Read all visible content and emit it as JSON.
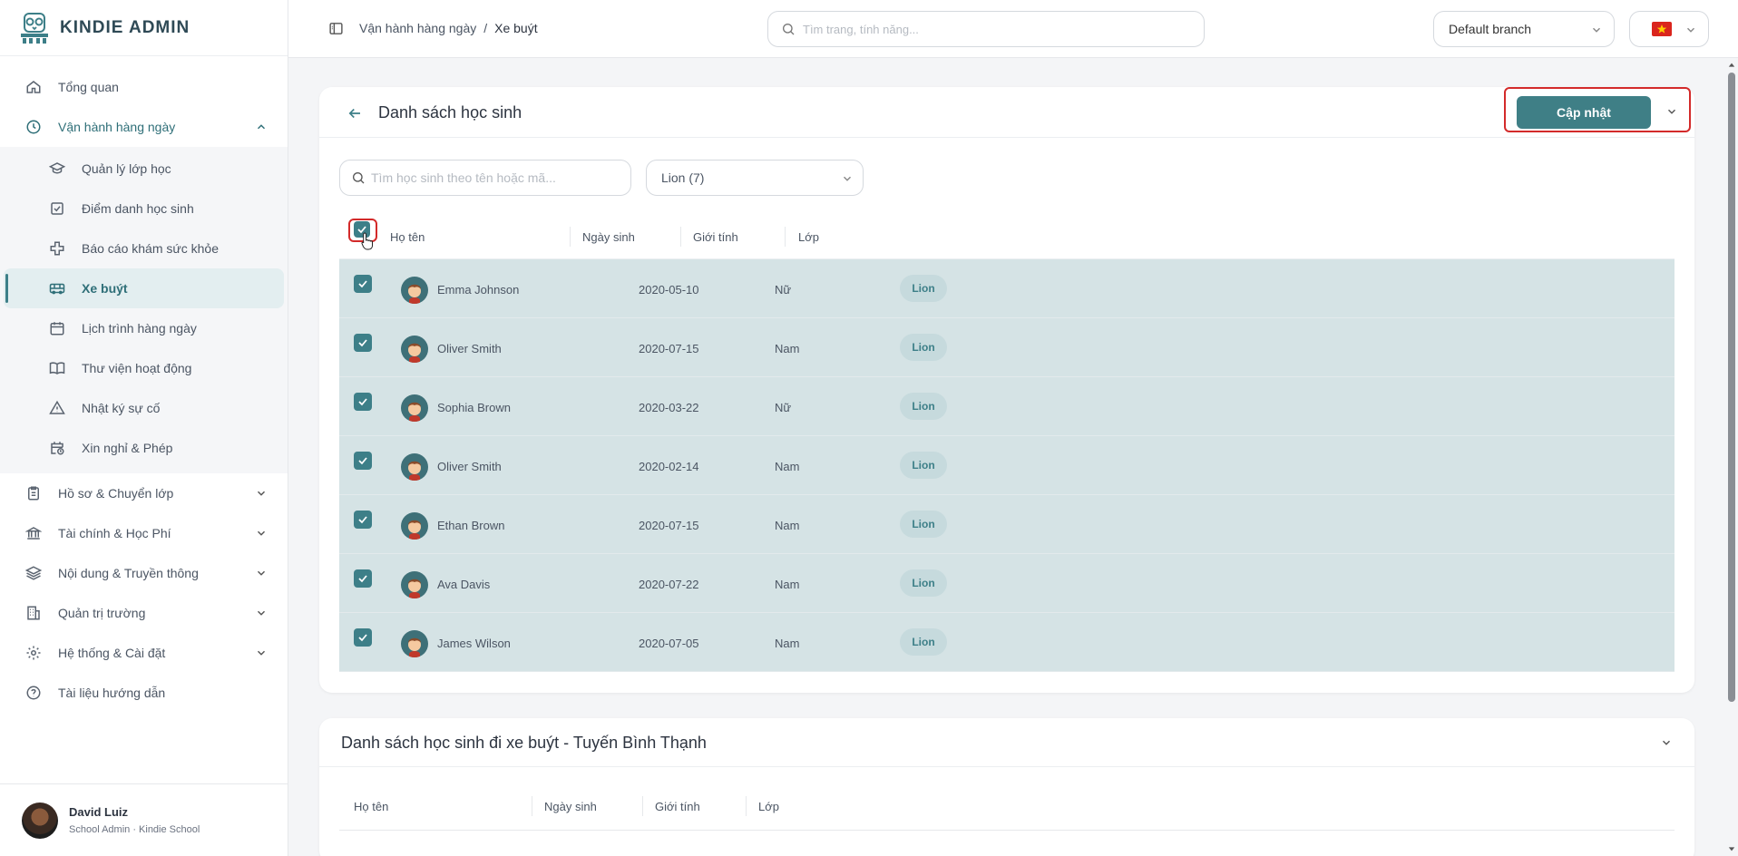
{
  "brand": {
    "name": "KINDIE ADMIN"
  },
  "sidebar": {
    "items": [
      {
        "label": "Tổng quan",
        "icon": "home-icon"
      },
      {
        "label": "Vận hành hàng ngày",
        "icon": "clock-icon"
      }
    ],
    "sub_items": [
      {
        "label": "Quản lý lớp học",
        "icon": "graduation-cap-icon"
      },
      {
        "label": "Điểm danh học sinh",
        "icon": "check-square-icon"
      },
      {
        "label": "Báo cáo khám sức khỏe",
        "icon": "health-cross-icon"
      },
      {
        "label": "Xe buýt",
        "icon": "bus-icon"
      },
      {
        "label": "Lịch trình hàng ngày",
        "icon": "calendar-icon"
      },
      {
        "label": "Thư viện hoạt động",
        "icon": "book-icon"
      },
      {
        "label": "Nhật ký sự cố",
        "icon": "alert-triangle-icon"
      },
      {
        "label": "Xin nghỉ & Phép",
        "icon": "calendar-clock-icon"
      }
    ],
    "groups": [
      {
        "label": "Hồ sơ & Chuyển lớp",
        "icon": "clipboard-icon"
      },
      {
        "label": "Tài chính & Học Phí",
        "icon": "bank-icon"
      },
      {
        "label": "Nội dung & Truyền thông",
        "icon": "layers-icon"
      },
      {
        "label": "Quản trị trường",
        "icon": "building-icon"
      },
      {
        "label": "Hệ thống & Cài đặt",
        "icon": "gear-icon"
      },
      {
        "label": "Tài liệu hướng dẫn",
        "icon": "help-circle-icon"
      }
    ]
  },
  "user": {
    "name": "David Luiz",
    "role": "School Admin · Kindie School"
  },
  "topbar": {
    "breadcrumb": [
      "Vận hành hàng ngày",
      "/",
      "Xe buýt"
    ],
    "search_placeholder": "Tìm trang, tính năng...",
    "branch": "Default branch"
  },
  "card": {
    "title": "Danh sách học sinh",
    "update_label": "Cập nhật",
    "search_placeholder": "Tìm học sinh theo tên hoặc mã...",
    "class_filter": "Lion (7)"
  },
  "table": {
    "columns": [
      "Họ tên",
      "Ngày sinh",
      "Giới tính",
      "Lớp"
    ],
    "rows": [
      {
        "name": "Emma Johnson",
        "dob": "2020-05-10",
        "gender": "Nữ",
        "class": "Lion"
      },
      {
        "name": "Oliver Smith",
        "dob": "2020-07-15",
        "gender": "Nam",
        "class": "Lion"
      },
      {
        "name": "Sophia Brown",
        "dob": "2020-03-22",
        "gender": "Nữ",
        "class": "Lion"
      },
      {
        "name": "Oliver Smith",
        "dob": "2020-02-14",
        "gender": "Nam",
        "class": "Lion"
      },
      {
        "name": "Ethan Brown",
        "dob": "2020-07-15",
        "gender": "Nam",
        "class": "Lion"
      },
      {
        "name": "Ava Davis",
        "dob": "2020-07-22",
        "gender": "Nam",
        "class": "Lion"
      },
      {
        "name": "James Wilson",
        "dob": "2020-07-05",
        "gender": "Nam",
        "class": "Lion"
      }
    ]
  },
  "card2": {
    "title": "Danh sách học sinh đi xe buýt - Tuyến Bình Thạnh",
    "columns": [
      "Họ tên",
      "Ngày sinh",
      "Giới tính",
      "Lớp"
    ]
  },
  "colors": {
    "accent": "#3f7f86",
    "highlight": "#d32a2a",
    "row_selected": "#d5e3e5"
  }
}
